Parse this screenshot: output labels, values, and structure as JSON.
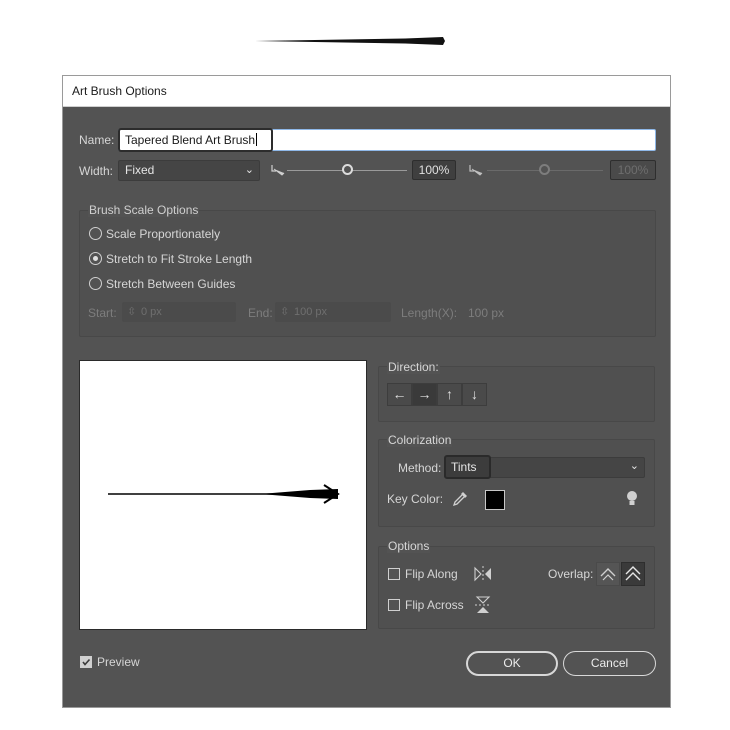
{
  "dialog": {
    "title": "Art Brush Options"
  },
  "name": {
    "label": "Name:",
    "value": "Tapered Blend Art Brush"
  },
  "width": {
    "label": "Width:",
    "select_value": "Fixed",
    "percent": "100%",
    "percent_disabled": "100%",
    "slider_fraction": 0.5
  },
  "brush_scale": {
    "title": "Brush Scale Options",
    "options": [
      "Scale Proportionately",
      "Stretch to Fit Stroke Length",
      "Stretch Between Guides"
    ],
    "selected_index": 1,
    "start_label": "Start:",
    "start_value": "0 px",
    "end_label": "End:",
    "end_value": "100 px",
    "length_label": "Length(X):",
    "length_value": "100 px"
  },
  "direction": {
    "label": "Direction:",
    "buttons": [
      "←",
      "→",
      "↑",
      "↓"
    ],
    "selected_index": 1
  },
  "colorization": {
    "title": "Colorization",
    "method_label": "Method:",
    "method_value": "Tints",
    "key_color_label": "Key Color:",
    "key_color": "#000000"
  },
  "options": {
    "title": "Options",
    "flip_along": "Flip Along",
    "flip_across": "Flip Across",
    "overlap_label": "Overlap:"
  },
  "preview": {
    "label": "Preview",
    "checked": true
  },
  "buttons": {
    "ok": "OK",
    "cancel": "Cancel"
  }
}
